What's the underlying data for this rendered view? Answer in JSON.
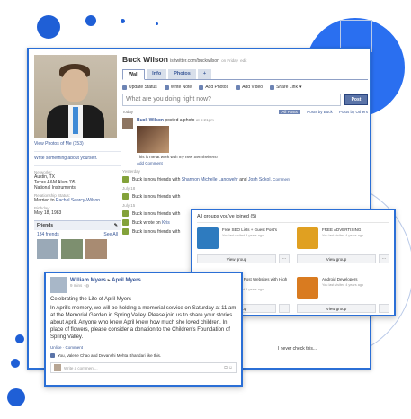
{
  "profile": {
    "name": "Buck Wilson",
    "url": "is twitter.com/buckwilson",
    "updated": "on Friday",
    "edit": "edit",
    "view_photos": "View Photos of Me (153)",
    "write_about": "Write something about yourself.",
    "networks_label": "Networks:",
    "networks": [
      "Austin, TX",
      "Texas A&M Alum '05",
      "National Instruments"
    ],
    "relationship_label": "Relationship Status:",
    "relationship_prefix": "Married to",
    "relationship_name": "Rachel Searcy-Wilson",
    "birthday_label": "Birthday:",
    "birthday": "May 18, 1983"
  },
  "friends_box": {
    "title": "Friends",
    "count": "134 friends",
    "see_all": "See All"
  },
  "tabs": [
    "Wall",
    "Info",
    "Photos",
    "+"
  ],
  "composer": {
    "actions": [
      "Update Status",
      "Write Note",
      "Add Photos",
      "Add Video",
      "Share Link"
    ],
    "placeholder": "What are you doing right now?",
    "post_label": "Post"
  },
  "filters": {
    "today": "Today",
    "options": [
      "All Posts",
      "Posts by Buck",
      "Posts by Others"
    ]
  },
  "story": {
    "actor": "Buck Wilson",
    "action": "posted a photo",
    "time": "at 5:21pm",
    "caption": "This is me at work with my new Sennheisers!",
    "add_comment": "Add Comment"
  },
  "activities": [
    {
      "date": "Yesterday",
      "text": "Buck is now friends with",
      "link1": "Shannon Michelle Landwehr",
      "mid": "and",
      "link2": "Josh Sokol.",
      "tail": "Comment"
    },
    {
      "date": "July 18",
      "text": "Buck is now friends with",
      "link1": "",
      "mid": "",
      "link2": "",
      "tail": ""
    },
    {
      "date": "July 15",
      "text": "Buck is now friends with",
      "link1": "",
      "mid": "",
      "link2": "",
      "tail": ""
    },
    {
      "date": "",
      "text": "Buck wrote on",
      "link1": "Kris",
      "mid": "",
      "link2": "",
      "tail": ""
    },
    {
      "date": "",
      "text": "Buck is now friends with",
      "link1": "",
      "mid": "",
      "link2": "",
      "tail": ""
    }
  ],
  "groups": {
    "title": "All groups you've joined (5)",
    "items": [
      {
        "name": "Free SEO Lists + Guest Post's",
        "meta": "You last visited 4 years ago",
        "color": "#2e7bbf"
      },
      {
        "name": "FREE ADVERTISING",
        "meta": "You last visited 4 years ago",
        "color": "#e0a021"
      },
      {
        "name": "Free Guest Post Websites with High DA PA",
        "meta": "You last visited 4 years ago",
        "color": "#f0b23a"
      },
      {
        "name": "Android Developers",
        "meta": "You last visited 4 years ago",
        "color": "#d97b20"
      }
    ],
    "view_label": "View group",
    "more_label": "···"
  },
  "post": {
    "author": "William Myers",
    "arrow": "▸",
    "target": "April Myers",
    "time": "9 mins ·",
    "title": "Celebrating the Life of April Myers",
    "body": "In April's memory, we will be holding a memorial service on Saturday at 11 am at the Memorial Garden in Spring Valley. Please join us to share your stories about April. Anyone who knew April knew how much she loved children. In place of flowers, please consider a donation to the Children's Foundation of Spring Valley.",
    "actions": "Unlike · Comment",
    "likes": "You, Valerie Chao and Devanshi Mehta Bhandari like this.",
    "comment_placeholder": "Write a comment...",
    "peek_text": "I never check this..."
  }
}
